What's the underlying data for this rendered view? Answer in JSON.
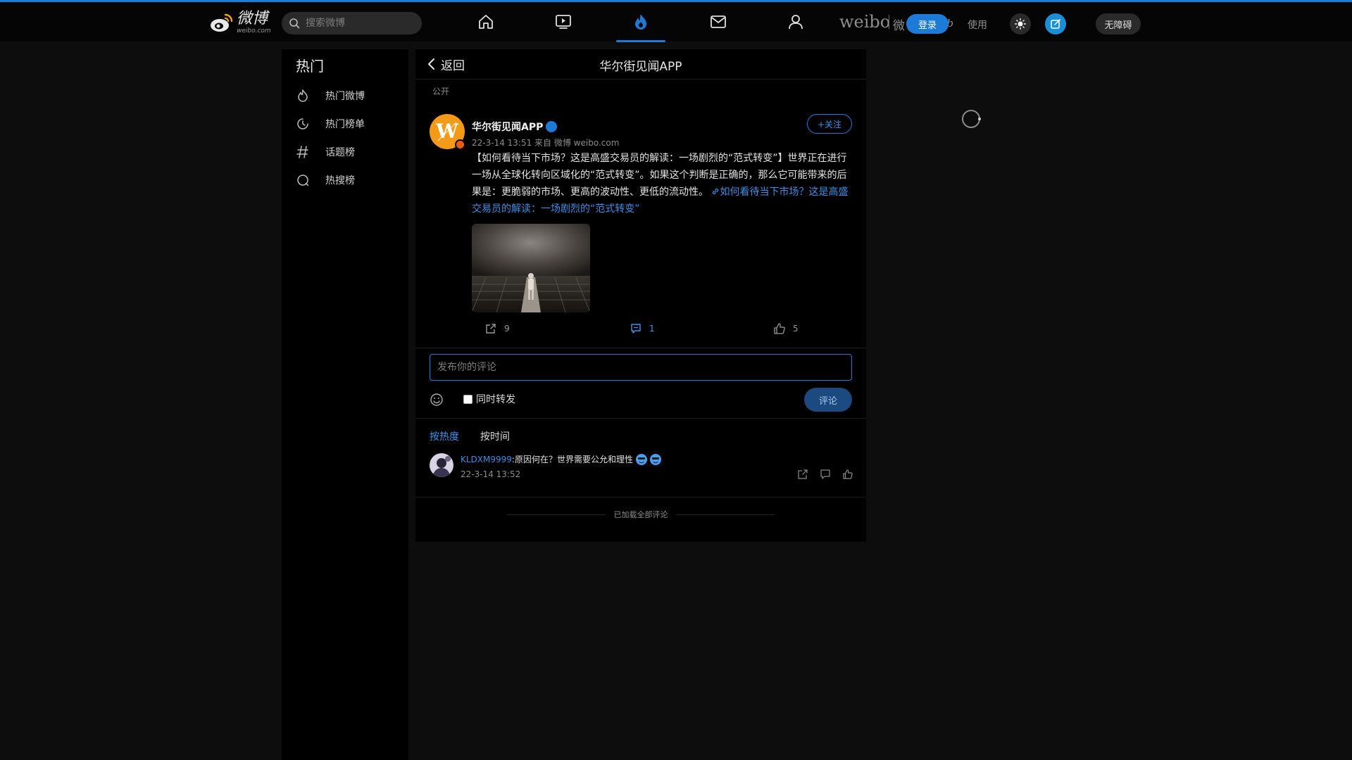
{
  "header": {
    "logo_text": "微博",
    "logo_url_text": "weibo.com",
    "search_placeholder": "搜索微博",
    "nav_items": [
      "home",
      "video",
      "hot",
      "messages",
      "profile"
    ],
    "brand": "weibo",
    "brand_cn": "微",
    "brand_italic": "weib",
    "brand_suffix": "使用",
    "login_label": "登录",
    "a11y_label": "无障碍",
    "accent_color": "#1d7bd8"
  },
  "sidebar": {
    "title": "热门",
    "items": [
      {
        "label": "热门微博",
        "icon": "flame-icon"
      },
      {
        "label": "热门榜单",
        "icon": "clock-icon"
      },
      {
        "label": "话题榜",
        "icon": "hashtag-icon"
      },
      {
        "label": "热搜榜",
        "icon": "search-circle-icon"
      }
    ]
  },
  "main": {
    "back_label": "返回",
    "title": "华尔街见闻APP",
    "visibility": "公开",
    "post": {
      "author": "华尔街见闻APP",
      "meta": "22-3-14 13:51  来自 微博 weibo.com",
      "follow_label": "+关注",
      "text": "【如何看待当下市场？这是高盛交易员的解读：一场剧烈的“范式转变”】世界正在进行一场从全球化转向区域化的“范式转变”。如果这个判断是正确的，那么它可能带来的后果是：更脆弱的市场、更高的波动性、更低的流动性。",
      "link_text": "如何看待当下市场？这是高盛交易员的解读：一场剧烈的“范式转变”",
      "reposts": "9",
      "comments": "1",
      "likes": "5"
    },
    "comment_box": {
      "placeholder": "发布你的评论",
      "repost_label": "同时转发",
      "submit_label": "评论"
    },
    "sort": {
      "hot_label": "按热度",
      "time_label": "按时间"
    },
    "comments": [
      {
        "user": "KLDXM9999",
        "text": ":原因何在？世界需要公允和理性",
        "time": "22-3-14 13:52"
      }
    ],
    "all_loaded": "已加载全部评论"
  }
}
